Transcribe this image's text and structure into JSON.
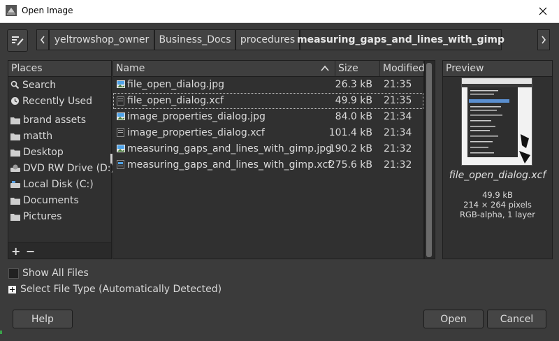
{
  "window": {
    "title": "Open Image",
    "close_icon": "close-icon"
  },
  "pathbar": {
    "crumbs": [
      "yeltrowshop_owner",
      "Business_Docs",
      "procedures",
      "measuring_gaps_and_lines_with_gimp"
    ]
  },
  "places": {
    "header": "Places",
    "items": [
      "Search",
      "Recently Used",
      "brand assets",
      "matth",
      "Desktop",
      "DVD RW Drive (D:)",
      "Local Disk (C:)",
      "Documents",
      "Pictures"
    ],
    "add_label": "+",
    "remove_label": "−"
  },
  "files": {
    "columns": {
      "name": "Name",
      "size": "Size",
      "modified": "Modified"
    },
    "rows": [
      {
        "name": "file_open_dialog.jpg",
        "size": "26.3 kB",
        "modified": "21:35",
        "type": "jpg"
      },
      {
        "name": "file_open_dialog.xcf",
        "size": "49.9 kB",
        "modified": "21:35",
        "type": "xcf",
        "selected": true
      },
      {
        "name": "image_properties_dialog.jpg",
        "size": "84.0 kB",
        "modified": "21:34",
        "type": "jpg"
      },
      {
        "name": "image_properties_dialog.xcf",
        "size": "101.4 kB",
        "modified": "21:34",
        "type": "xcf"
      },
      {
        "name": "measuring_gaps_and_lines_with_gimp.jpg",
        "size": "190.2 kB",
        "modified": "21:32",
        "type": "jpg"
      },
      {
        "name": "measuring_gaps_and_lines_with_gimp.xcf",
        "size": "275.6 kB",
        "modified": "21:32",
        "type": "xcf"
      }
    ]
  },
  "preview": {
    "header": "Preview",
    "filename": "file_open_dialog.xcf",
    "size": "49.9 kB",
    "dimensions": "214 × 264 pixels",
    "mode": "RGB-alpha, 1 layer"
  },
  "options": {
    "show_all_files": "Show All Files",
    "select_file_type": "Select File Type (Automatically Detected)"
  },
  "buttons": {
    "help": "Help",
    "open": "Open",
    "cancel": "Cancel"
  }
}
